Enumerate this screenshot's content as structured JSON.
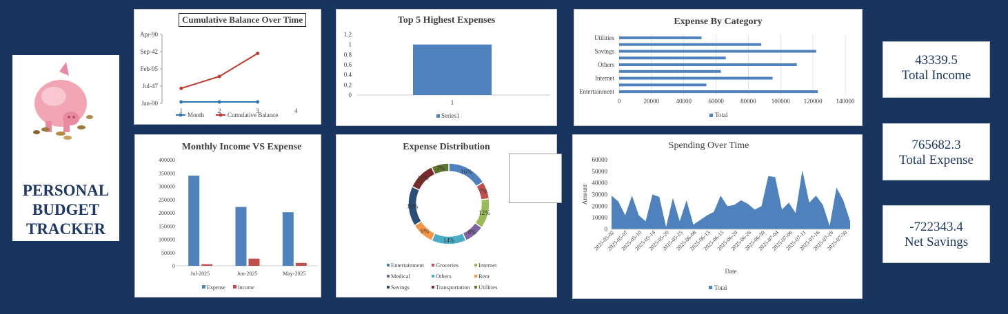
{
  "brand": {
    "title_lines": [
      "PERSONAL",
      "BUDGET",
      "TRACKER"
    ]
  },
  "kpis": [
    {
      "value": "43339.5",
      "label": "Total Income"
    },
    {
      "value": "765682.3",
      "label": "Total Expense"
    },
    {
      "value": "-722343.4",
      "label": "Net Savings"
    }
  ],
  "chart_data": [
    {
      "id": "cumulative",
      "type": "line",
      "title": "Cumulative Balance Over Time",
      "x": [
        1,
        2,
        3,
        4
      ],
      "ytick_labels": [
        "Jan-00",
        "Jul-47",
        "Feb-95",
        "Sep-42",
        "Apr-90"
      ],
      "series": [
        {
          "name": "Month",
          "color": "#2e75b6",
          "values": [
            1,
            2,
            3
          ]
        },
        {
          "name": "Cumulative Balance",
          "color": "#c0392b",
          "values": [
            43339.5,
            78000,
            145000
          ]
        }
      ]
    },
    {
      "id": "top5",
      "type": "bar",
      "title": "Top 5 Highest Expenses",
      "categories": [
        "1"
      ],
      "series": [
        {
          "name": "Series1",
          "color": "#4f81bd",
          "values": [
            1
          ]
        }
      ],
      "ylim": [
        0,
        1.2
      ],
      "yticks": [
        "0",
        "0.2",
        "0.4",
        "0.6",
        "0.8",
        "1",
        "1.2"
      ]
    },
    {
      "id": "category",
      "type": "bar",
      "orientation": "horizontal",
      "title": "Expense By Category",
      "categories": [
        "Entertainment",
        "Groceries",
        "Internet",
        "Medical",
        "Others",
        "Rent",
        "Savings",
        "Transportation",
        "Utilities"
      ],
      "category_labels_shown": [
        "Entertainment",
        "Internet",
        "Others",
        "Savings",
        "Utilities"
      ],
      "series": [
        {
          "name": "Total",
          "color": "#4f81bd",
          "values": [
            123000,
            54000,
            95000,
            63000,
            110000,
            66000,
            122000,
            88000,
            51000
          ]
        }
      ],
      "xlim": [
        0,
        140000
      ],
      "xticks": [
        "0",
        "20000",
        "40000",
        "60000",
        "80000",
        "100000",
        "120000",
        "140000"
      ]
    },
    {
      "id": "monthly",
      "type": "bar",
      "title": "Monthly Income VS Expense",
      "categories": [
        "Jul-2025",
        "Jun-2025",
        "May-2025"
      ],
      "series": [
        {
          "name": "Expense",
          "color": "#4f81bd",
          "values": [
            340000,
            222000,
            202000
          ]
        },
        {
          "name": "Income",
          "color": "#c0504d",
          "values": [
            6000,
            27000,
            11000
          ]
        }
      ],
      "ylim": [
        0,
        400000
      ],
      "yticks": [
        "0",
        "50000",
        "100000",
        "150000",
        "200000",
        "250000",
        "300000",
        "350000",
        "400000"
      ]
    },
    {
      "id": "distribution",
      "type": "pie",
      "title": "Expense Distribution",
      "slices": [
        {
          "name": "Entertainment",
          "value": 16,
          "label": "16%",
          "color": "#4f81bd"
        },
        {
          "name": "Groceries",
          "value": 7,
          "label": "7%",
          "color": "#c0504d"
        },
        {
          "name": "Internet",
          "value": 12,
          "label": "12%",
          "color": "#9bbb59"
        },
        {
          "name": "Medical",
          "value": 8,
          "label": "8%",
          "color": "#8064a2"
        },
        {
          "name": "Others",
          "value": 14,
          "label": "14%",
          "color": "#4bacc6"
        },
        {
          "name": "Rent",
          "value": 9,
          "label": "9%",
          "color": "#f79646"
        },
        {
          "name": "Savings",
          "value": 16,
          "label": "16%",
          "color": "#2c4d75"
        },
        {
          "name": "Transportation",
          "value": 11,
          "label": "11%",
          "color": "#772c2a"
        },
        {
          "name": "Utilities",
          "value": 7,
          "label": "7%",
          "color": "#5f7530"
        }
      ]
    },
    {
      "id": "spending",
      "type": "area",
      "title": "Spending Over Time",
      "xlabel": "Date",
      "ylabel": "Amount",
      "xtick_labels": [
        "2025-05-02",
        "2025-05-07",
        "2025-05-10",
        "2025-05-14",
        "2025-05-20",
        "2025-05-25",
        "2025-06-08",
        "2025-06-13",
        "2025-06-15",
        "2025-06-20",
        "2025-06-26",
        "2025-06-30",
        "2025-07-04",
        "2025-07-06",
        "2025-07-11",
        "2025-07-16",
        "2025-07-20",
        "2025-07-30"
      ],
      "series": [
        {
          "name": "Total",
          "color": "#4f81bd",
          "values": [
            29000,
            24000,
            12000,
            29000,
            12000,
            7000,
            30000,
            28000,
            2000,
            27000,
            7000,
            25000,
            4000,
            8000,
            12000,
            15000,
            29000,
            20000,
            21000,
            25000,
            22000,
            17000,
            20000,
            46000,
            45000,
            17000,
            23000,
            14000,
            51000,
            23000,
            29000,
            21000,
            3000,
            36000,
            25000,
            7000
          ]
        }
      ],
      "ylim": [
        0,
        60000
      ],
      "yticks": [
        "0",
        "10000",
        "20000",
        "30000",
        "40000",
        "50000",
        "60000"
      ]
    }
  ]
}
